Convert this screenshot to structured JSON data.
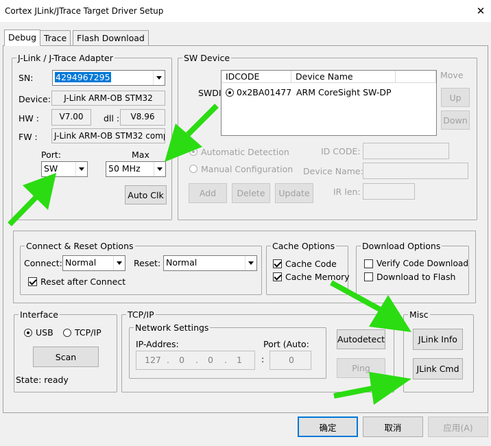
{
  "window": {
    "title": "Cortex JLink/JTrace Target Driver Setup",
    "close": "✕"
  },
  "tabs": [
    "Debug",
    "Trace",
    "Flash Download"
  ],
  "adapter": {
    "legend": "J-Link / J-Trace Adapter",
    "sn_label": "SN:",
    "sn_value": "4294967295",
    "device_label": "Device:",
    "device_value": "J-Link ARM-OB STM32",
    "hw_label": "HW :",
    "hw_value": "V7.00",
    "dll_label": "dll :",
    "dll_value": "V8.96",
    "fw_label": "FW :",
    "fw_value": "J-Link ARM-OB STM32 comp",
    "port_label": "Port:",
    "port_value": "SW",
    "max_label": "Max",
    "max_value": "50 MHz",
    "autoclk": "Auto Clk"
  },
  "swdevice": {
    "legend": "SW Device",
    "swdi_label": "SWDI",
    "col_idcode": "IDCODE",
    "col_name": "Device Name",
    "row_idcode": "0x2BA01477",
    "row_name": "ARM CoreSight SW-DP",
    "move_label": "Move",
    "up": "Up",
    "down": "Down",
    "auto_detect": "Automatic Detection",
    "manual_config": "Manual Configuration",
    "idcode_label": "ID CODE:",
    "devname_label": "Device Name:",
    "irlen_label": "IR len:",
    "add": "Add",
    "delete": "Delete",
    "update": "Update"
  },
  "connect": {
    "legend": "Connect & Reset Options",
    "connect_label": "Connect:",
    "connect_value": "Normal",
    "reset_label": "Reset:",
    "reset_value": "Normal",
    "reset_after": "Reset after Connect"
  },
  "cache": {
    "legend": "Cache Options",
    "code": "Cache Code",
    "memory": "Cache Memory"
  },
  "download": {
    "legend": "Download Options",
    "verify": "Verify Code Download",
    "to_flash": "Download to Flash"
  },
  "interface": {
    "legend": "Interface",
    "usb": "USB",
    "tcpip": "TCP/IP",
    "scan": "Scan",
    "state": "State: ready"
  },
  "tcpip": {
    "legend": "TCP/IP",
    "net_legend": "Network Settings",
    "ip_label": "IP-Addres:",
    "port_label": "Port (Auto:",
    "ip": [
      "127",
      ".",
      "0",
      ".",
      "0",
      ".",
      "1"
    ],
    "colon": ":",
    "port": "0",
    "autodetect": "Autodetect",
    "ping": "Ping"
  },
  "misc": {
    "legend": "Misc",
    "jlink_info": "JLink Info",
    "jlink_cmd": "JLink Cmd"
  },
  "footer": {
    "ok": "确定",
    "cancel": "取消",
    "apply": "应用(A)"
  },
  "annotation_color": "#2bdc12"
}
